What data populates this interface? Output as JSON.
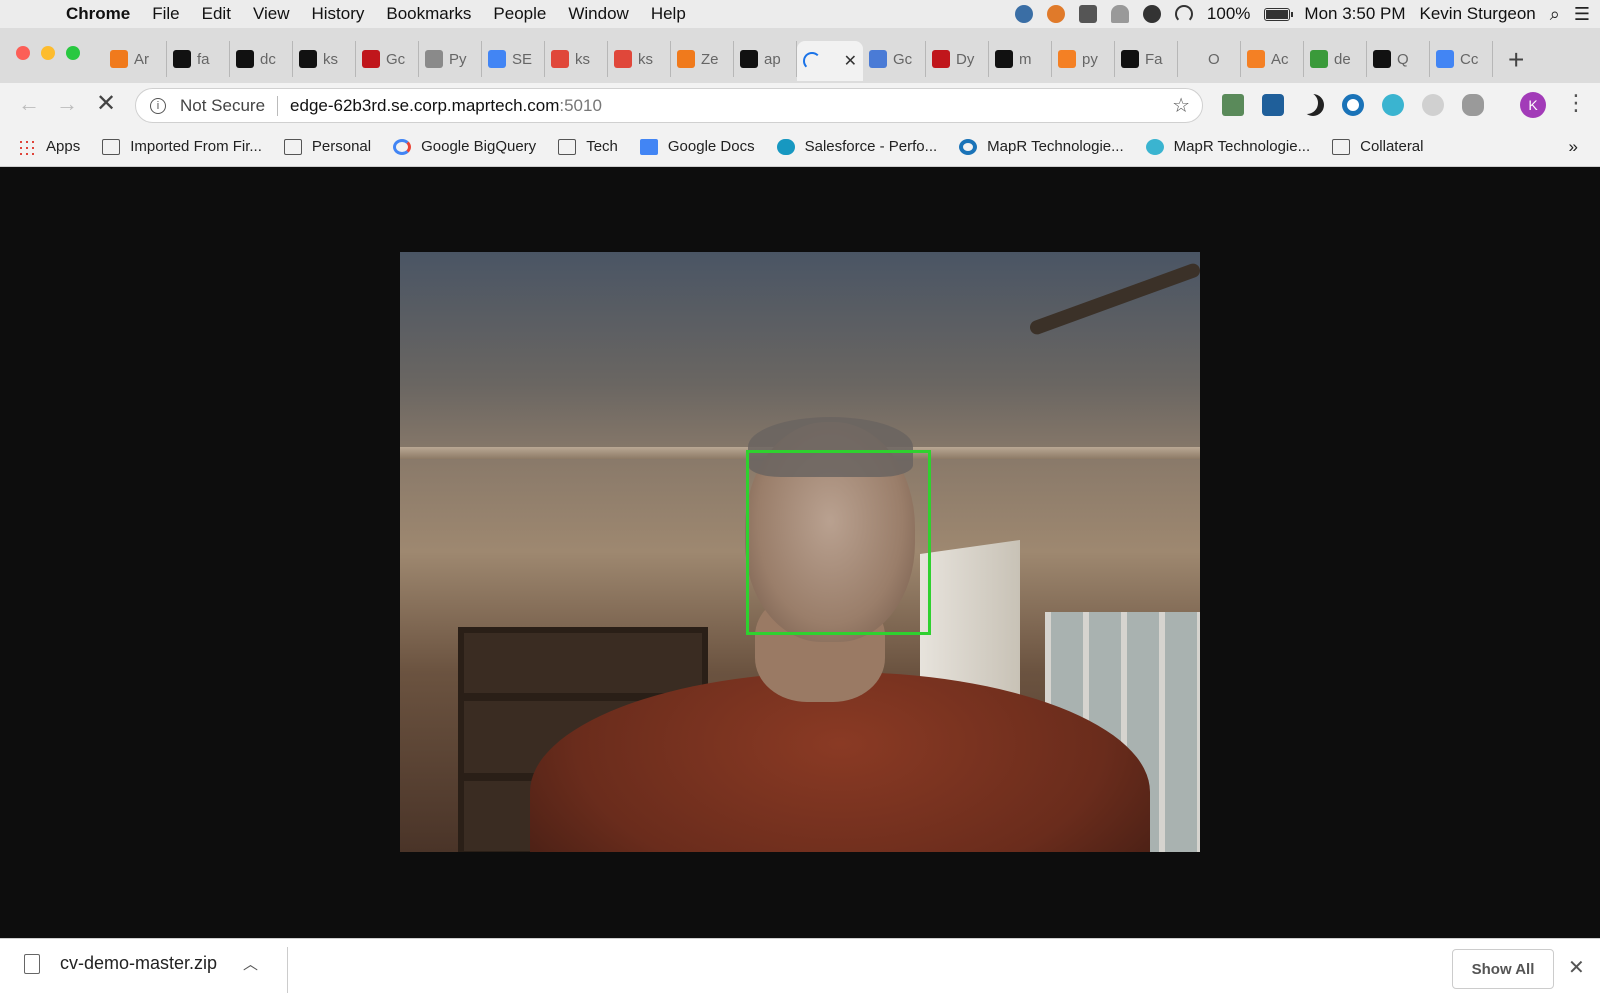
{
  "menubar": {
    "app_name": "Chrome",
    "items": [
      "File",
      "Edit",
      "View",
      "History",
      "Bookmarks",
      "People",
      "Window",
      "Help"
    ],
    "battery_text": "100%",
    "battery_level": 1.0,
    "clock": "Mon 3:50 PM",
    "user": "Kevin Sturgeon"
  },
  "tabs": [
    {
      "label": "Ar",
      "icon": "box-icon",
      "color": "#f07a1c"
    },
    {
      "label": "fa",
      "icon": "github-icon",
      "color": "#111111"
    },
    {
      "label": "dc",
      "icon": "github-icon",
      "color": "#111111"
    },
    {
      "label": "ks",
      "icon": "github-icon",
      "color": "#111111"
    },
    {
      "label": "Gc",
      "icon": "mapr-icon",
      "color": "#c0161c"
    },
    {
      "label": "Py",
      "icon": "file-icon",
      "color": "#8a8a8a"
    },
    {
      "label": "SE",
      "icon": "docs-icon",
      "color": "#4285f4"
    },
    {
      "label": "ks",
      "icon": "gear-icon",
      "color": "#e0473a"
    },
    {
      "label": "ks",
      "icon": "gear-icon",
      "color": "#e0473a"
    },
    {
      "label": "Ze",
      "icon": "zeppelin-icon",
      "color": "#f07a1c"
    },
    {
      "label": "ap",
      "icon": "share-icon",
      "color": "#111111"
    },
    {
      "label": "",
      "icon": "loading-icon",
      "color": "#1a73e8",
      "active": true
    },
    {
      "label": "Gc",
      "icon": "drive-icon",
      "color": "#4a7bd6"
    },
    {
      "label": "Dy",
      "icon": "mapr-icon",
      "color": "#c0161c"
    },
    {
      "label": "m",
      "icon": "github-icon",
      "color": "#111111"
    },
    {
      "label": "py",
      "icon": "stackoverflow-icon",
      "color": "#f48024"
    },
    {
      "label": "Fa",
      "icon": "github-icon",
      "color": "#111111"
    },
    {
      "label": "O",
      "icon": "blank-icon",
      "color": "#dcdcdc"
    },
    {
      "label": "Ac",
      "icon": "stackoverflow-icon",
      "color": "#f48024"
    },
    {
      "label": "de",
      "icon": "pencil-icon",
      "color": "#3a9a3a"
    },
    {
      "label": "Q",
      "icon": "moon-icon",
      "color": "#111111"
    },
    {
      "label": "Cc",
      "icon": "docs-icon",
      "color": "#4285f4"
    }
  ],
  "omnibox": {
    "security_label": "Not Secure",
    "host": "edge-62b3rd.se.corp.maprtech.com",
    "port": ":5010"
  },
  "avatar_letter": "K",
  "bookmarks": [
    {
      "label": "Apps",
      "icon": "apps-grid-icon"
    },
    {
      "label": "Imported From Fir...",
      "icon": "folder-icon"
    },
    {
      "label": "Personal",
      "icon": "folder-icon"
    },
    {
      "label": "Google BigQuery",
      "icon": "google-icon"
    },
    {
      "label": "Tech",
      "icon": "folder-icon"
    },
    {
      "label": "Google Docs",
      "icon": "docs-icon"
    },
    {
      "label": "Salesforce - Perfo...",
      "icon": "salesforce-icon"
    },
    {
      "label": "MapR Technologie...",
      "icon": "mapr-ring-icon"
    },
    {
      "label": "MapR Technologie...",
      "icon": "mapr-globe-icon"
    },
    {
      "label": "Collateral",
      "icon": "folder-icon"
    }
  ],
  "bookmarks_overflow": "»",
  "download": {
    "filename": "cv-demo-master.zip",
    "show_all": "Show All"
  },
  "colors": {
    "face_box": "#2fd12f",
    "page_background": "#0d0d0d"
  }
}
